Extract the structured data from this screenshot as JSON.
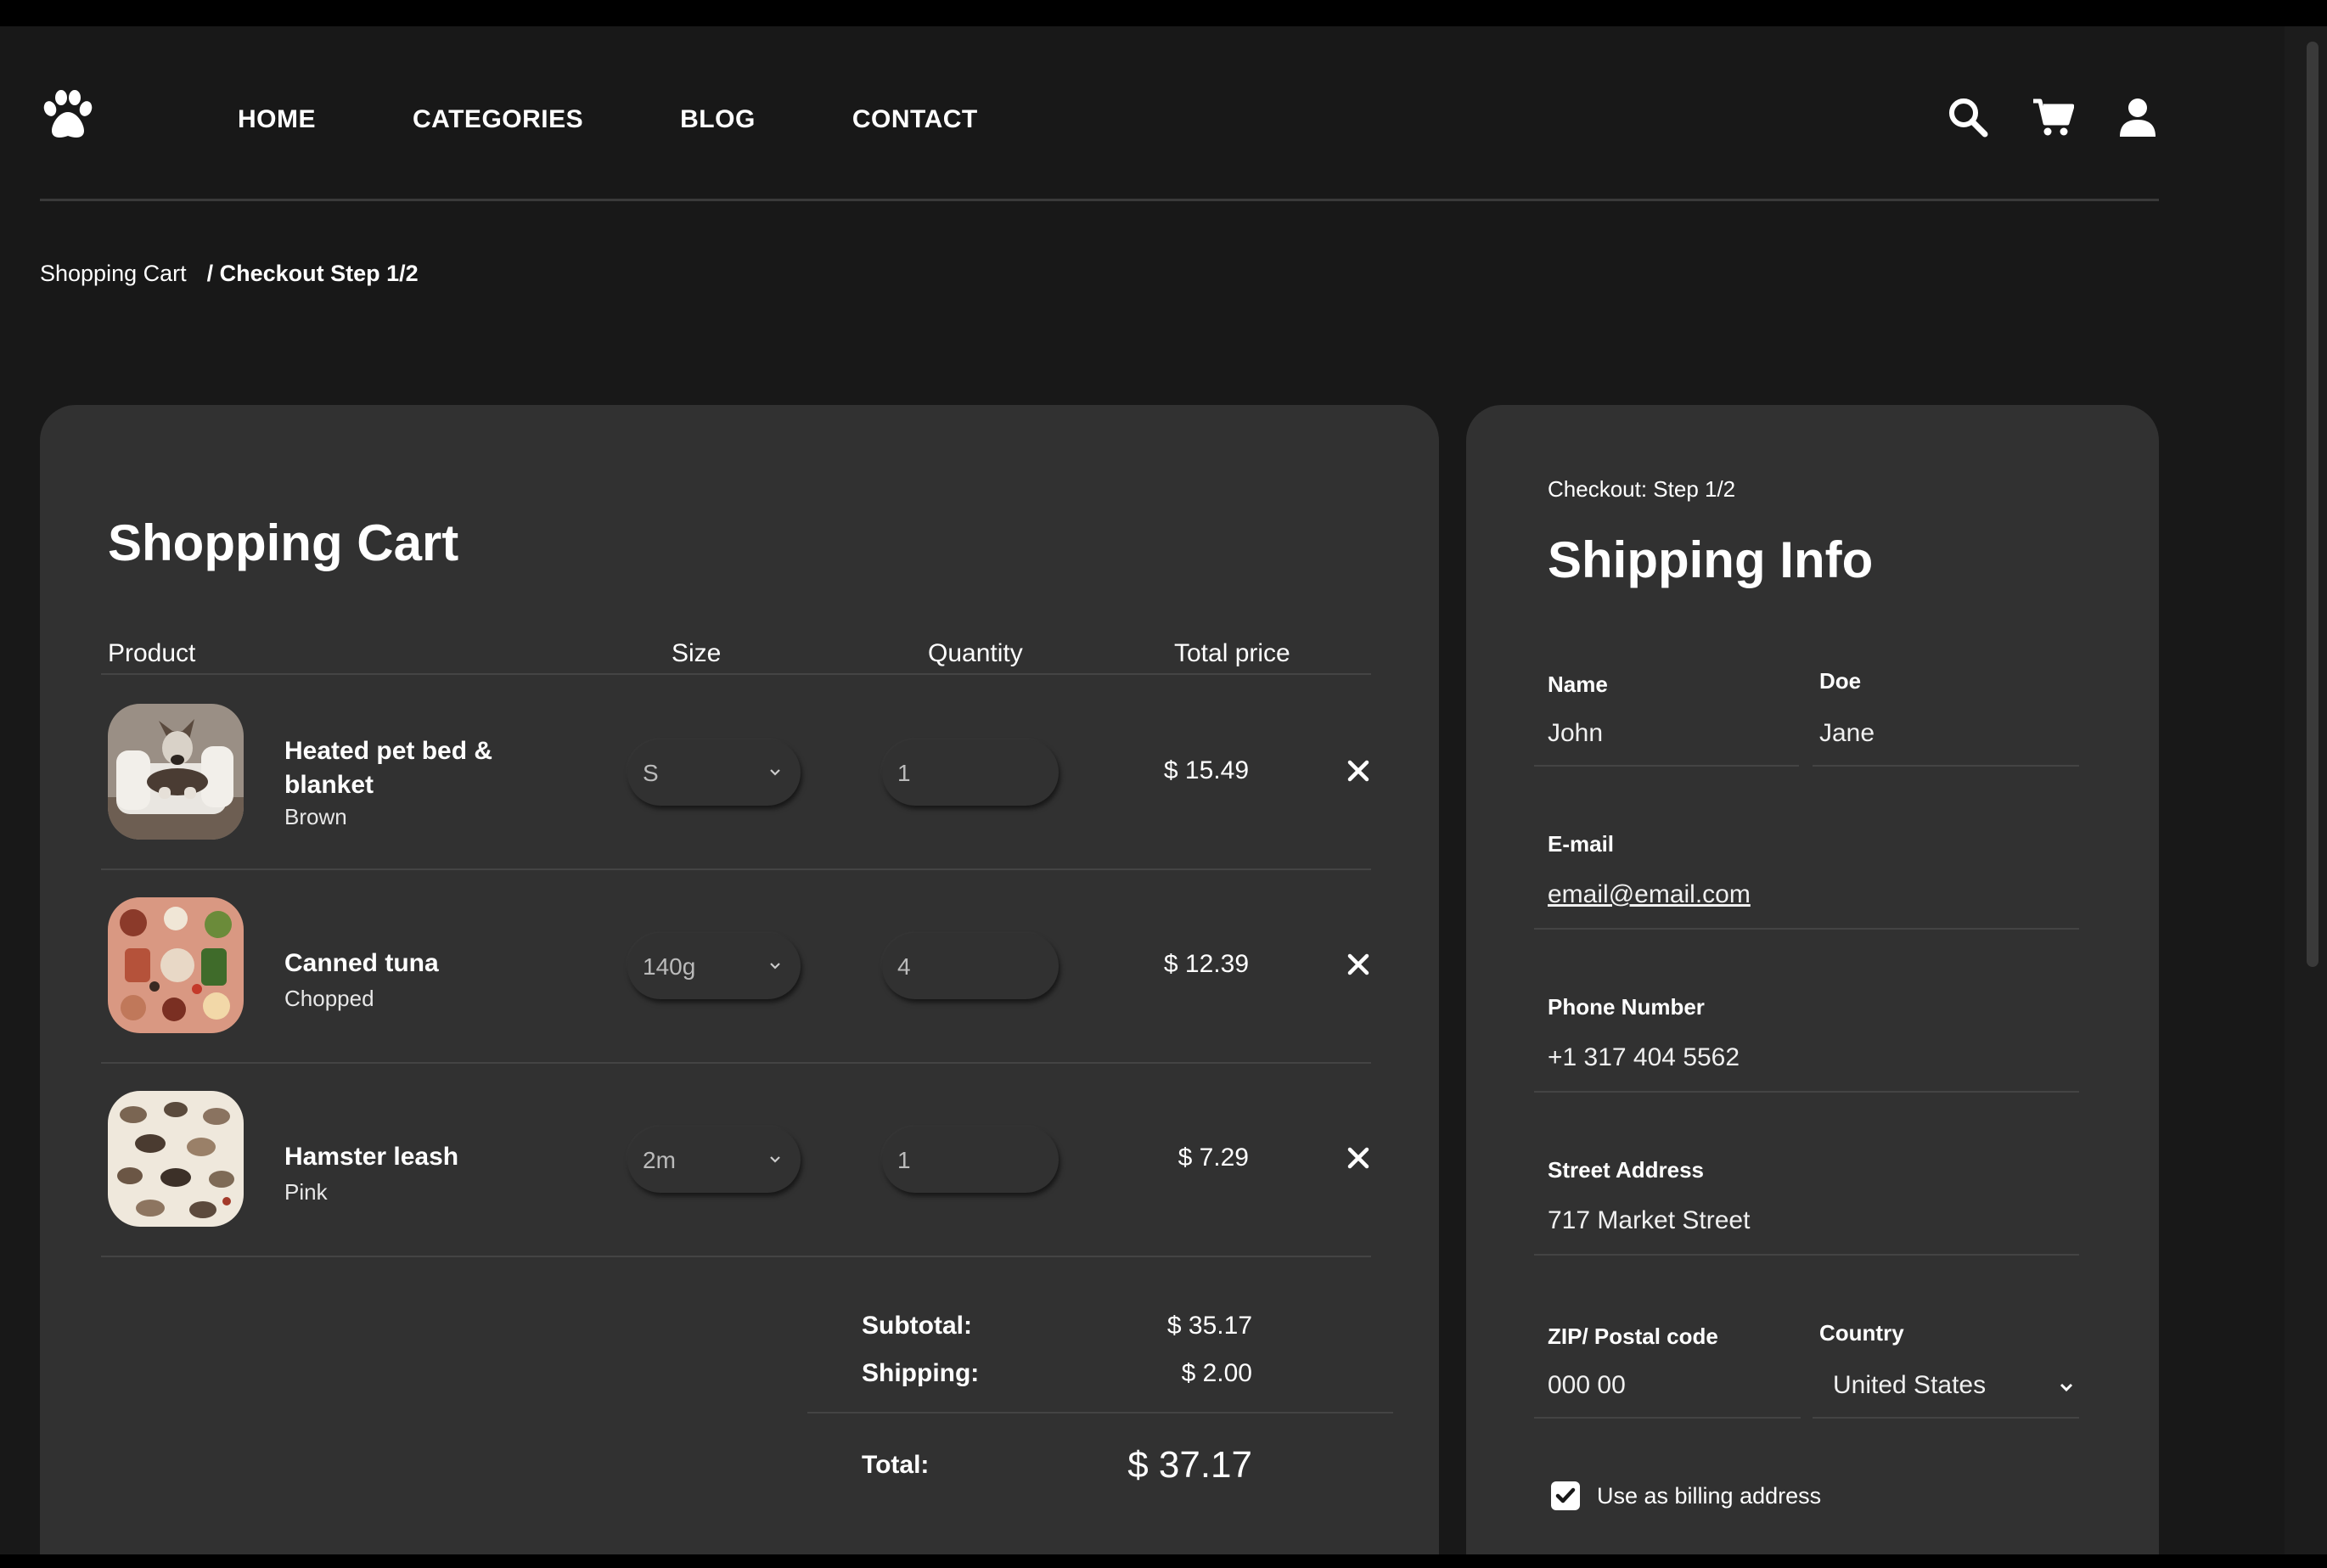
{
  "nav": {
    "items": [
      "HOME",
      "CATEGORIES",
      "BLOG",
      "CONTACT"
    ],
    "icons": [
      "search-icon",
      "cart-icon",
      "user-icon"
    ],
    "logo": "paw-icon"
  },
  "breadcrumb": {
    "parent": "Shopping Cart",
    "current": "/ Checkout Step 1/2"
  },
  "cart": {
    "title": "Shopping Cart",
    "columns": {
      "product": "Product",
      "size": "Size",
      "quantity": "Quantity",
      "total": "Total price"
    },
    "items": [
      {
        "name": "Heated pet bed & blanket",
        "variant": "Brown",
        "size": "S",
        "quantity": "1",
        "price": "$ 15.49"
      },
      {
        "name": "Canned tuna",
        "variant": "Chopped",
        "size": "140g",
        "quantity": "4",
        "price": "$ 12.39"
      },
      {
        "name": "Hamster leash",
        "variant": "Pink",
        "size": "2m",
        "quantity": "1",
        "price": "$ 7.29"
      }
    ],
    "summary": {
      "subtotal_label": "Subtotal:",
      "subtotal": "$ 35.17",
      "shipping_label": "Shipping:",
      "shipping": "$ 2.00",
      "total_label": "Total:",
      "total": "$ 37.17"
    }
  },
  "shipping": {
    "step": "Checkout: Step 1/2",
    "title": "Shipping Info",
    "first_name_label": "Name",
    "first_name": "John",
    "last_name_label": "Doe",
    "last_name": "Jane",
    "email_label": "E-mail",
    "email": "email@email.com",
    "phone_label": "Phone Number",
    "phone": "+1 317 404 5562",
    "street_label": "Street Address",
    "street": "717 Market Street",
    "zip_label": "ZIP/ Postal code",
    "zip": "000 00",
    "country_label": "Country",
    "country": "United States",
    "billing_label": "Use as billing address",
    "billing_checked": true
  },
  "colors": {
    "background": "#181818",
    "panel": "#313131",
    "text": "#ffffff",
    "divider": "#444444"
  }
}
